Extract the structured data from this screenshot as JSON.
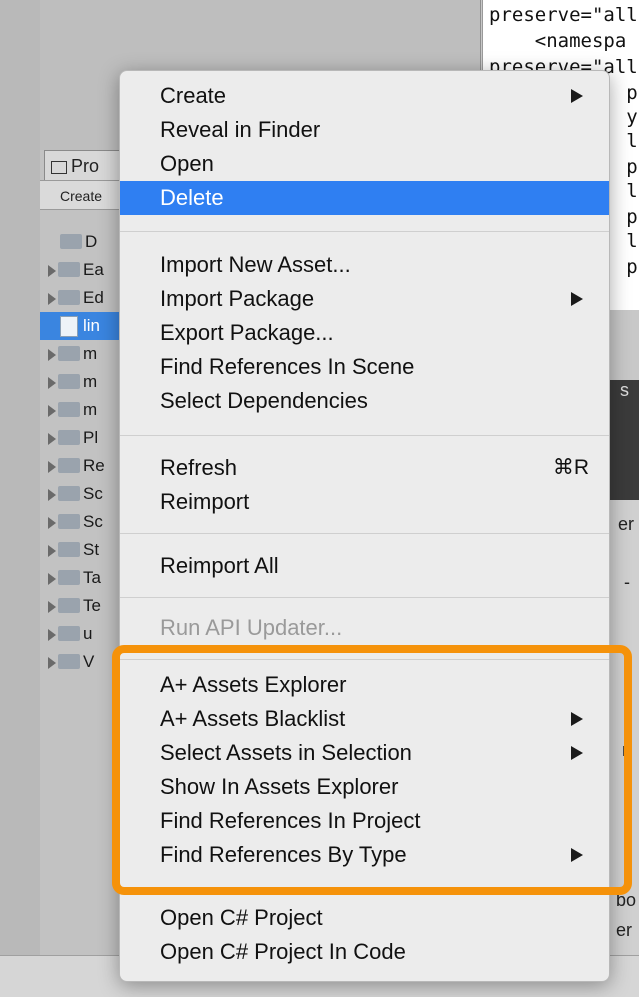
{
  "code_panel": {
    "lines": [
      "preserve=\"all\",",
      "    <namespa",
      "preserve=\"all\",",
      "            pa",
      "            yst",
      "            ll\",",
      "            pa",
      "            ll\",",
      "            pa",
      "            ll\",",
      "            ply"
    ]
  },
  "project_panel": {
    "tab_label": "Pro",
    "toolbar_label": "Create",
    "items": [
      {
        "label": "D",
        "type": "folder",
        "expandable": false
      },
      {
        "label": "Ea",
        "type": "folder",
        "expandable": true
      },
      {
        "label": "Ed",
        "type": "folder",
        "expandable": true
      },
      {
        "label": "lin",
        "type": "file",
        "expandable": false,
        "selected": true
      },
      {
        "label": "m",
        "type": "folder",
        "expandable": true
      },
      {
        "label": "m",
        "type": "folder",
        "expandable": true
      },
      {
        "label": "m",
        "type": "folder",
        "expandable": true
      },
      {
        "label": "Pl",
        "type": "folder",
        "expandable": true
      },
      {
        "label": "Re",
        "type": "folder",
        "expandable": true
      },
      {
        "label": "Sc",
        "type": "folder",
        "expandable": true
      },
      {
        "label": "Sc",
        "type": "folder",
        "expandable": true
      },
      {
        "label": "St",
        "type": "folder",
        "expandable": true
      },
      {
        "label": "Ta",
        "type": "folder",
        "expandable": true
      },
      {
        "label": "Te",
        "type": "folder",
        "expandable": true
      },
      {
        "label": "u",
        "type": "folder",
        "expandable": true
      },
      {
        "label": "V",
        "type": "folder",
        "expandable": true
      }
    ]
  },
  "side_fragments": {
    "s": "s",
    "er": "er",
    "dash": "-",
    "n": "n",
    "bo": "bo",
    "er2": "er"
  },
  "context_menu": {
    "items": [
      {
        "label": "Create",
        "submenu": true
      },
      {
        "label": "Reveal in Finder"
      },
      {
        "label": "Open"
      },
      {
        "label": "Delete",
        "highlighted": true
      },
      {
        "separator": true
      },
      {
        "label": "Import New Asset..."
      },
      {
        "label": "Import Package",
        "submenu": true
      },
      {
        "label": "Export Package..."
      },
      {
        "label": "Find References In Scene"
      },
      {
        "label": "Select Dependencies"
      },
      {
        "separator": true
      },
      {
        "label": "Refresh",
        "shortcut": "⌘R"
      },
      {
        "label": "Reimport"
      },
      {
        "separator": true
      },
      {
        "label": "Reimport All"
      },
      {
        "separator": true
      },
      {
        "label": "Run API Updater...",
        "disabled": true
      },
      {
        "separator": true
      },
      {
        "label": "A+ Assets Explorer"
      },
      {
        "label": "A+ Assets Blacklist",
        "submenu": true
      },
      {
        "label": "Select Assets in Selection",
        "submenu": true
      },
      {
        "label": "Show In Assets Explorer"
      },
      {
        "label": "Find References In Project"
      },
      {
        "label": "Find References By Type",
        "submenu": true
      },
      {
        "separator": true
      },
      {
        "label": "Open C# Project"
      },
      {
        "label": "Open C# Project In Code"
      }
    ]
  },
  "colors": {
    "highlight": "#2f7ff2",
    "annotation_box": "#f5920a",
    "selection": "#3a85e0"
  }
}
